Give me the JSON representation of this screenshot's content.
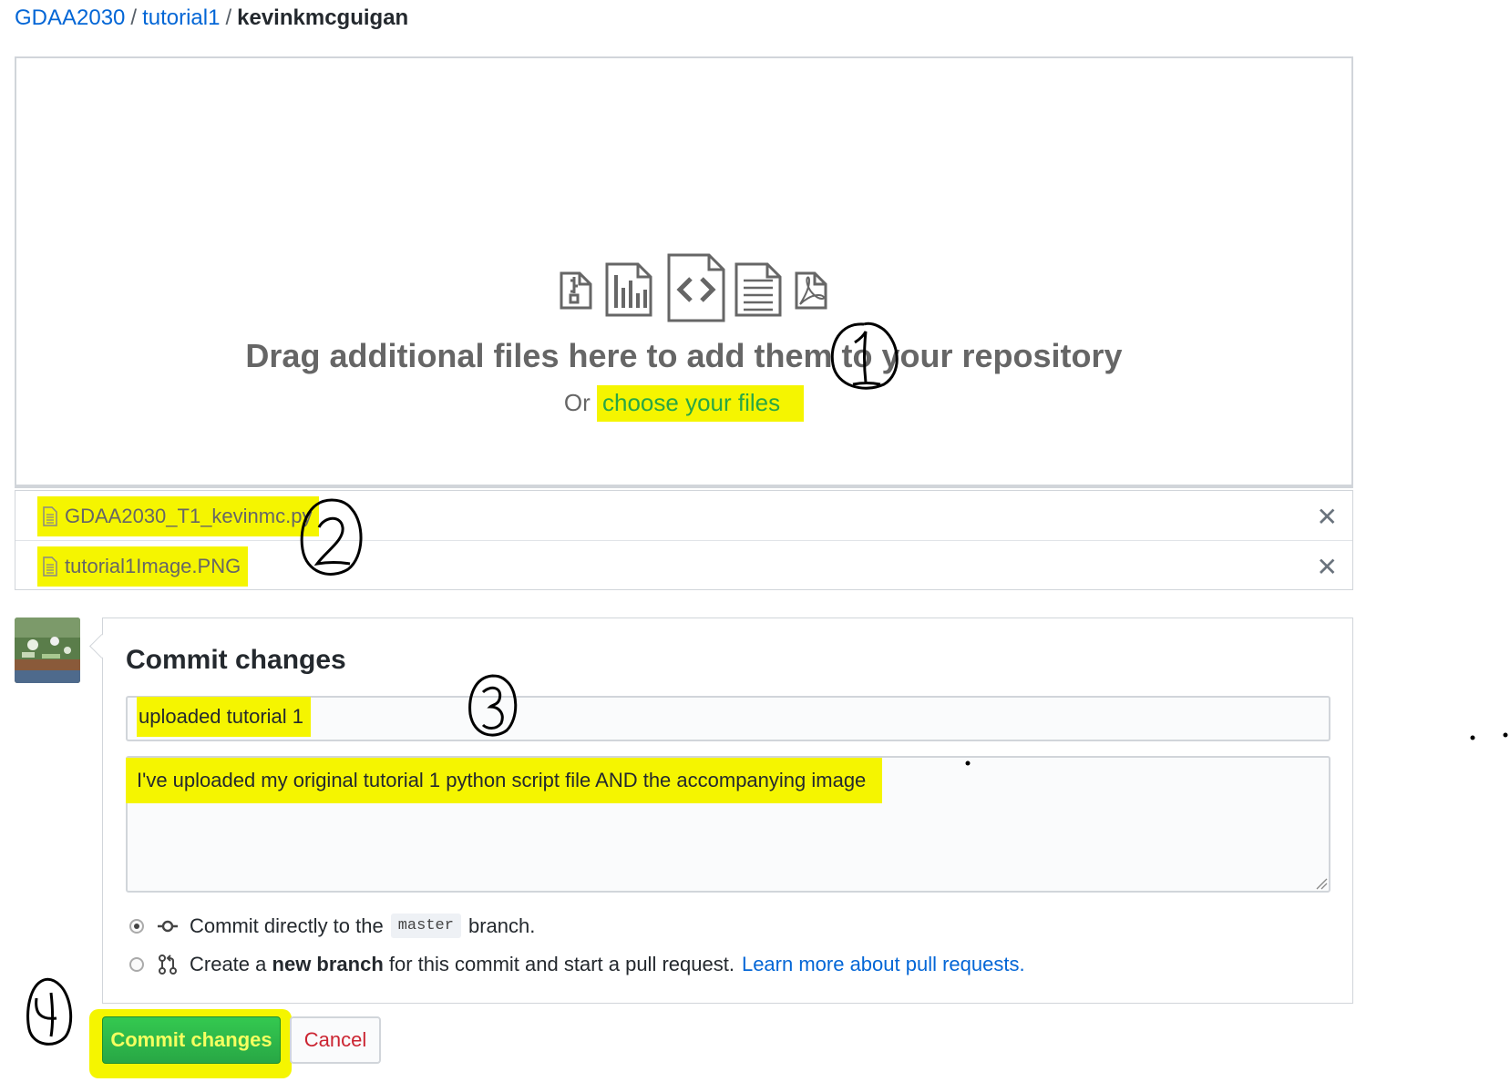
{
  "breadcrumb": {
    "owner": "GDAA2030",
    "repo": "tutorial1",
    "current": "kevinkmcguigan",
    "separator": "/"
  },
  "dropzone": {
    "icons": [
      "zip-file-icon",
      "chart-file-icon",
      "code-file-icon",
      "text-file-icon",
      "pdf-file-icon"
    ],
    "title": "Drag additional files here to add them to your repository",
    "sub_prefix": "Or",
    "choose_label": "choose your files"
  },
  "files": [
    {
      "name": "GDAA2030_T1_kevinmc.py",
      "remove": "✕"
    },
    {
      "name": "tutorial1Image.PNG",
      "remove": "✕"
    }
  ],
  "commit": {
    "heading": "Commit changes",
    "summary_value": "uploaded tutorial 1",
    "description_value": "I've uploaded my original tutorial 1 python script file AND the accompanying image",
    "option_direct": {
      "prefix": "Commit directly to the",
      "branch": "master",
      "suffix": "branch.",
      "checked": true
    },
    "option_new_branch": {
      "prefix": "Create a",
      "bold": "new branch",
      "suffix": "for this commit and start a pull request.",
      "link": "Learn more about pull requests.",
      "checked": false
    }
  },
  "buttons": {
    "commit": "Commit changes",
    "cancel": "Cancel"
  },
  "colors": {
    "link": "#0366d6",
    "highlight": "#f5f500",
    "green": "#28a745",
    "cancel": "#cb2431"
  }
}
